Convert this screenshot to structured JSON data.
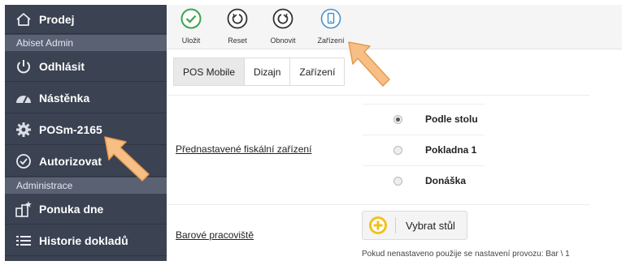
{
  "sidebar": {
    "items": [
      {
        "label": "Prodej",
        "icon": "home-icon"
      },
      {
        "label": "Odhlásit",
        "icon": "power-icon"
      },
      {
        "label": "Nástěnka",
        "icon": "dashboard-icon"
      },
      {
        "label": "POSm-2165",
        "icon": "gear-icon"
      },
      {
        "label": "Autorizovat",
        "icon": "check-circle-icon"
      },
      {
        "label": "Ponuka dne",
        "icon": "daily-menu-icon"
      },
      {
        "label": "Historie dokladů",
        "icon": "list-icon"
      }
    ],
    "sections": [
      "Abiset Admin",
      "Administrace"
    ]
  },
  "toolbar": {
    "buttons": [
      {
        "label": "Uložit",
        "icon": "check-icon",
        "color": "#3aa64a"
      },
      {
        "label": "Reset",
        "icon": "reset-icon",
        "color": "#333333"
      },
      {
        "label": "Obnovit",
        "icon": "refresh-icon",
        "color": "#333333"
      },
      {
        "label": "Zařízení",
        "icon": "device-icon",
        "color": "#4a90c9"
      }
    ]
  },
  "tabs": [
    {
      "label": "POS Mobile",
      "active": true
    },
    {
      "label": "Dizajn",
      "active": false
    },
    {
      "label": "Zařízení",
      "active": false
    }
  ],
  "form": {
    "fiscal_label": "Přednastavené fiskální zařízení",
    "fiscal_options": [
      {
        "label": "Podle stolu",
        "checked": true
      },
      {
        "label": "Pokladna 1",
        "checked": false
      },
      {
        "label": "Donáška",
        "checked": false
      }
    ],
    "bar_label": "Barové pracoviště",
    "select_table_label": "Vybrat stůl",
    "hint": "Pokud nenastaveno použije se nastavení provozu: Bar \\ 1"
  },
  "colors": {
    "sidebar_bg": "#3b4252",
    "section_bg": "#596173",
    "accent_green": "#3aa64a",
    "accent_blue": "#4a90c9",
    "plus_yellow": "#f2c21b",
    "arrow_orange": "#f5b56b"
  }
}
